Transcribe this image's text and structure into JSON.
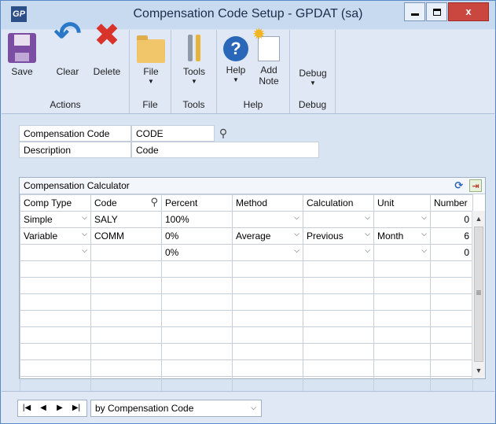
{
  "window": {
    "title": "Compensation Code Setup  -  GPDAT (sa)",
    "app_icon": "GP",
    "controls": {
      "minimize": "minimize-icon",
      "maximize": "maximize-icon",
      "close": "x"
    }
  },
  "ribbon": {
    "groups": [
      {
        "label": "Actions",
        "buttons": [
          {
            "label": "Save",
            "icon": "save-icon"
          },
          {
            "label": "Clear",
            "icon": "undo-icon"
          },
          {
            "label": "Delete",
            "icon": "delete-icon"
          }
        ]
      },
      {
        "label": "File",
        "buttons": [
          {
            "label": "File",
            "icon": "folder-icon",
            "has_menu": true
          }
        ]
      },
      {
        "label": "Tools",
        "buttons": [
          {
            "label": "Tools",
            "icon": "tools-icon",
            "has_menu": true
          }
        ]
      },
      {
        "label": "Help",
        "buttons": [
          {
            "label": "Help",
            "icon": "help-icon",
            "has_menu": true
          },
          {
            "label": "Add Note",
            "label_line1": "Add",
            "label_line2": "Note",
            "icon": "note-icon"
          }
        ]
      },
      {
        "label": "Debug",
        "buttons": [
          {
            "label": "Debug",
            "has_menu": true
          }
        ]
      }
    ]
  },
  "header": {
    "compensation_code_label": "Compensation Code",
    "compensation_code_value": "CODE",
    "description_label": "Description",
    "description_value": "Code"
  },
  "grid": {
    "title": "Compensation Calculator",
    "columns": [
      "Comp Type",
      "Code",
      "Percent",
      "Method",
      "Calculation",
      "Unit",
      "Number"
    ],
    "rows": [
      {
        "comp_type": "Simple",
        "code": "SALY",
        "percent": "100%",
        "method": "",
        "calculation": "",
        "unit": "",
        "number": "0"
      },
      {
        "comp_type": "Variable",
        "code": "COMM",
        "percent": "0%",
        "method": "Average",
        "calculation": "Previous",
        "unit": "Month",
        "number": "6"
      },
      {
        "comp_type": "",
        "code": "",
        "percent": "0%",
        "method": "",
        "calculation": "",
        "unit": "",
        "number": "0"
      }
    ],
    "empty_rows": 8
  },
  "navigation": {
    "first": "|◀",
    "prev": "◀",
    "next": "▶",
    "last": "▶|",
    "sort_by": "by Compensation Code"
  },
  "glyphs": {
    "dropdown": "⌵",
    "lookup": "⚲",
    "refresh": "⟳",
    "scroll_up": "▲",
    "scroll_down": "▼",
    "menu_arrow": "▼",
    "help": "?"
  }
}
